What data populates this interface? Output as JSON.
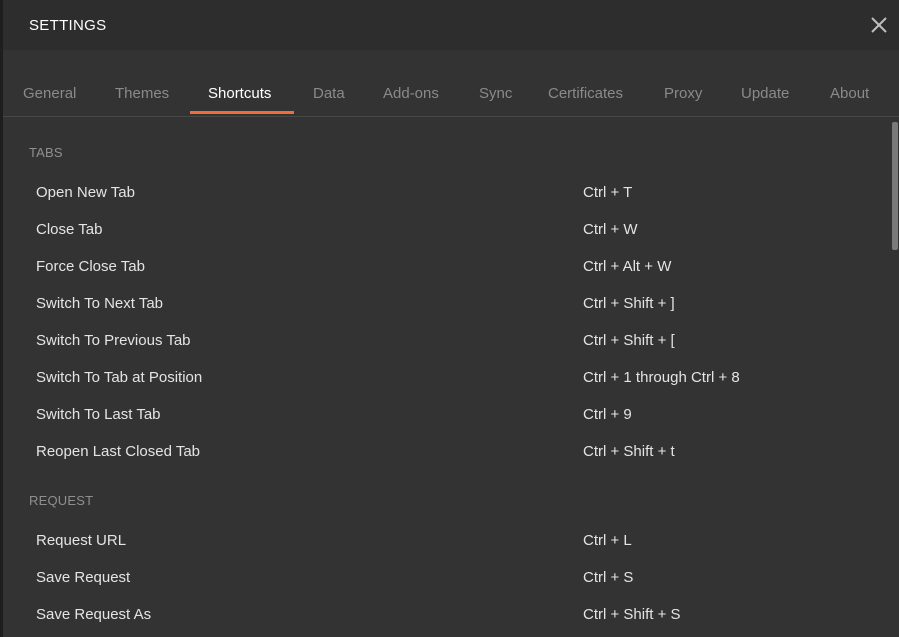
{
  "dialog": {
    "title": "SETTINGS",
    "close_icon": "close-icon"
  },
  "tabs": [
    {
      "label": "General",
      "active": false
    },
    {
      "label": "Themes",
      "active": false
    },
    {
      "label": "Shortcuts",
      "active": true
    },
    {
      "label": "Data",
      "active": false
    },
    {
      "label": "Add-ons",
      "active": false
    },
    {
      "label": "Sync",
      "active": false
    },
    {
      "label": "Certificates",
      "active": false
    },
    {
      "label": "Proxy",
      "active": false
    },
    {
      "label": "Update",
      "active": false
    },
    {
      "label": "About",
      "active": false
    }
  ],
  "sections": [
    {
      "header": "TABS",
      "rows": [
        {
          "action": "Open New Tab",
          "shortcut": "Ctrl + T"
        },
        {
          "action": "Close Tab",
          "shortcut": "Ctrl + W"
        },
        {
          "action": "Force Close Tab",
          "shortcut": "Ctrl + Alt + W"
        },
        {
          "action": "Switch To Next Tab",
          "shortcut": "Ctrl + Shift + ]"
        },
        {
          "action": "Switch To Previous Tab",
          "shortcut": "Ctrl + Shift + ["
        },
        {
          "action": "Switch To Tab at Position",
          "shortcut": "Ctrl + 1 through Ctrl + 8"
        },
        {
          "action": "Switch To Last Tab",
          "shortcut": "Ctrl + 9"
        },
        {
          "action": "Reopen Last Closed Tab",
          "shortcut": "Ctrl + Shift + t"
        }
      ]
    },
    {
      "header": "REQUEST",
      "rows": [
        {
          "action": "Request URL",
          "shortcut": "Ctrl + L"
        },
        {
          "action": "Save Request",
          "shortcut": "Ctrl + S"
        },
        {
          "action": "Save Request As",
          "shortcut": "Ctrl + Shift + S"
        }
      ]
    }
  ],
  "colors": {
    "accent": "#f26b3a",
    "dialog_bg": "#333333",
    "titlebar_bg": "#2d2d2d",
    "text_primary": "#e4e4e4",
    "text_muted": "#8a8a8a"
  }
}
